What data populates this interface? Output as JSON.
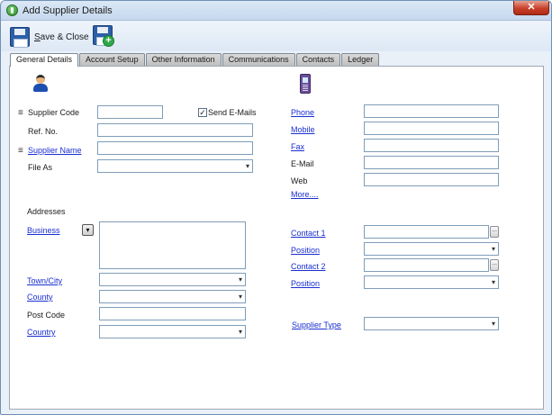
{
  "window": {
    "title": "Add Supplier Details",
    "close_glyph": "✕"
  },
  "toolbar": {
    "save_close_prefix": "S",
    "save_close_rest": "ave & Close"
  },
  "tabs": [
    "General Details",
    "Account Setup",
    "Other Information",
    "Communications",
    "Contacts",
    "Ledger"
  ],
  "general": {
    "required_mark": "≡",
    "supplier_code_label": "Supplier Code",
    "send_emails_label": "Send E-Mails",
    "send_emails_checked": "✓",
    "ref_no_label": "Ref. No.",
    "supplier_name_label": "Supplier Name",
    "file_as_label": "File As"
  },
  "addresses": {
    "heading": "Addresses",
    "business_label": "Business",
    "town_city_label": "Town/City",
    "county_label": "County",
    "post_code_label": "Post Code",
    "country_label": "Country",
    "dropdown_glyph": "▾"
  },
  "comms": {
    "phone_label": "Phone",
    "mobile_label": "Mobile",
    "fax_label": "Fax",
    "email_label": "E-Mail",
    "web_label": "Web",
    "more_label": "More...."
  },
  "contacts": {
    "contact1_label": "Contact 1",
    "position1_label": "Position",
    "contact2_label": "Contact 2",
    "position2_label": "Position",
    "ellipsis": "..."
  },
  "supplier_type": {
    "label": "Supplier Type"
  },
  "colors": {
    "link": "#1a2fd0",
    "title_bar": "#c6d8ee",
    "close": "#c8402a",
    "input_border": "#7f9db9"
  }
}
